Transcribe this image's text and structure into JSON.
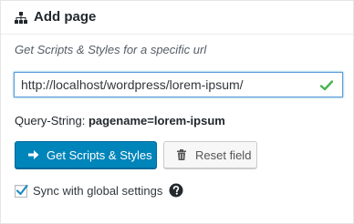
{
  "header": {
    "title": "Add page",
    "icon": "sitemap-icon"
  },
  "subtitle": "Get Scripts & Styles for a specific url",
  "url_input": {
    "value": "http://localhost/wordpress/lorem-ipsum/",
    "status_icon": "check-icon"
  },
  "query_string": {
    "label": "Query-String:",
    "value": "pagename=lorem-ipsum"
  },
  "buttons": {
    "primary": {
      "label": "Get Scripts & Styles",
      "icon": "arrow-right-icon"
    },
    "secondary": {
      "label": "Reset field",
      "icon": "trash-icon"
    }
  },
  "sync": {
    "label": "Sync with global settings",
    "checked": true,
    "help_icon": "help-icon"
  },
  "colors": {
    "accent": "#0085ba",
    "focus_border": "#5b9dd9",
    "check_green": "#46b450",
    "text": "#23282d"
  }
}
